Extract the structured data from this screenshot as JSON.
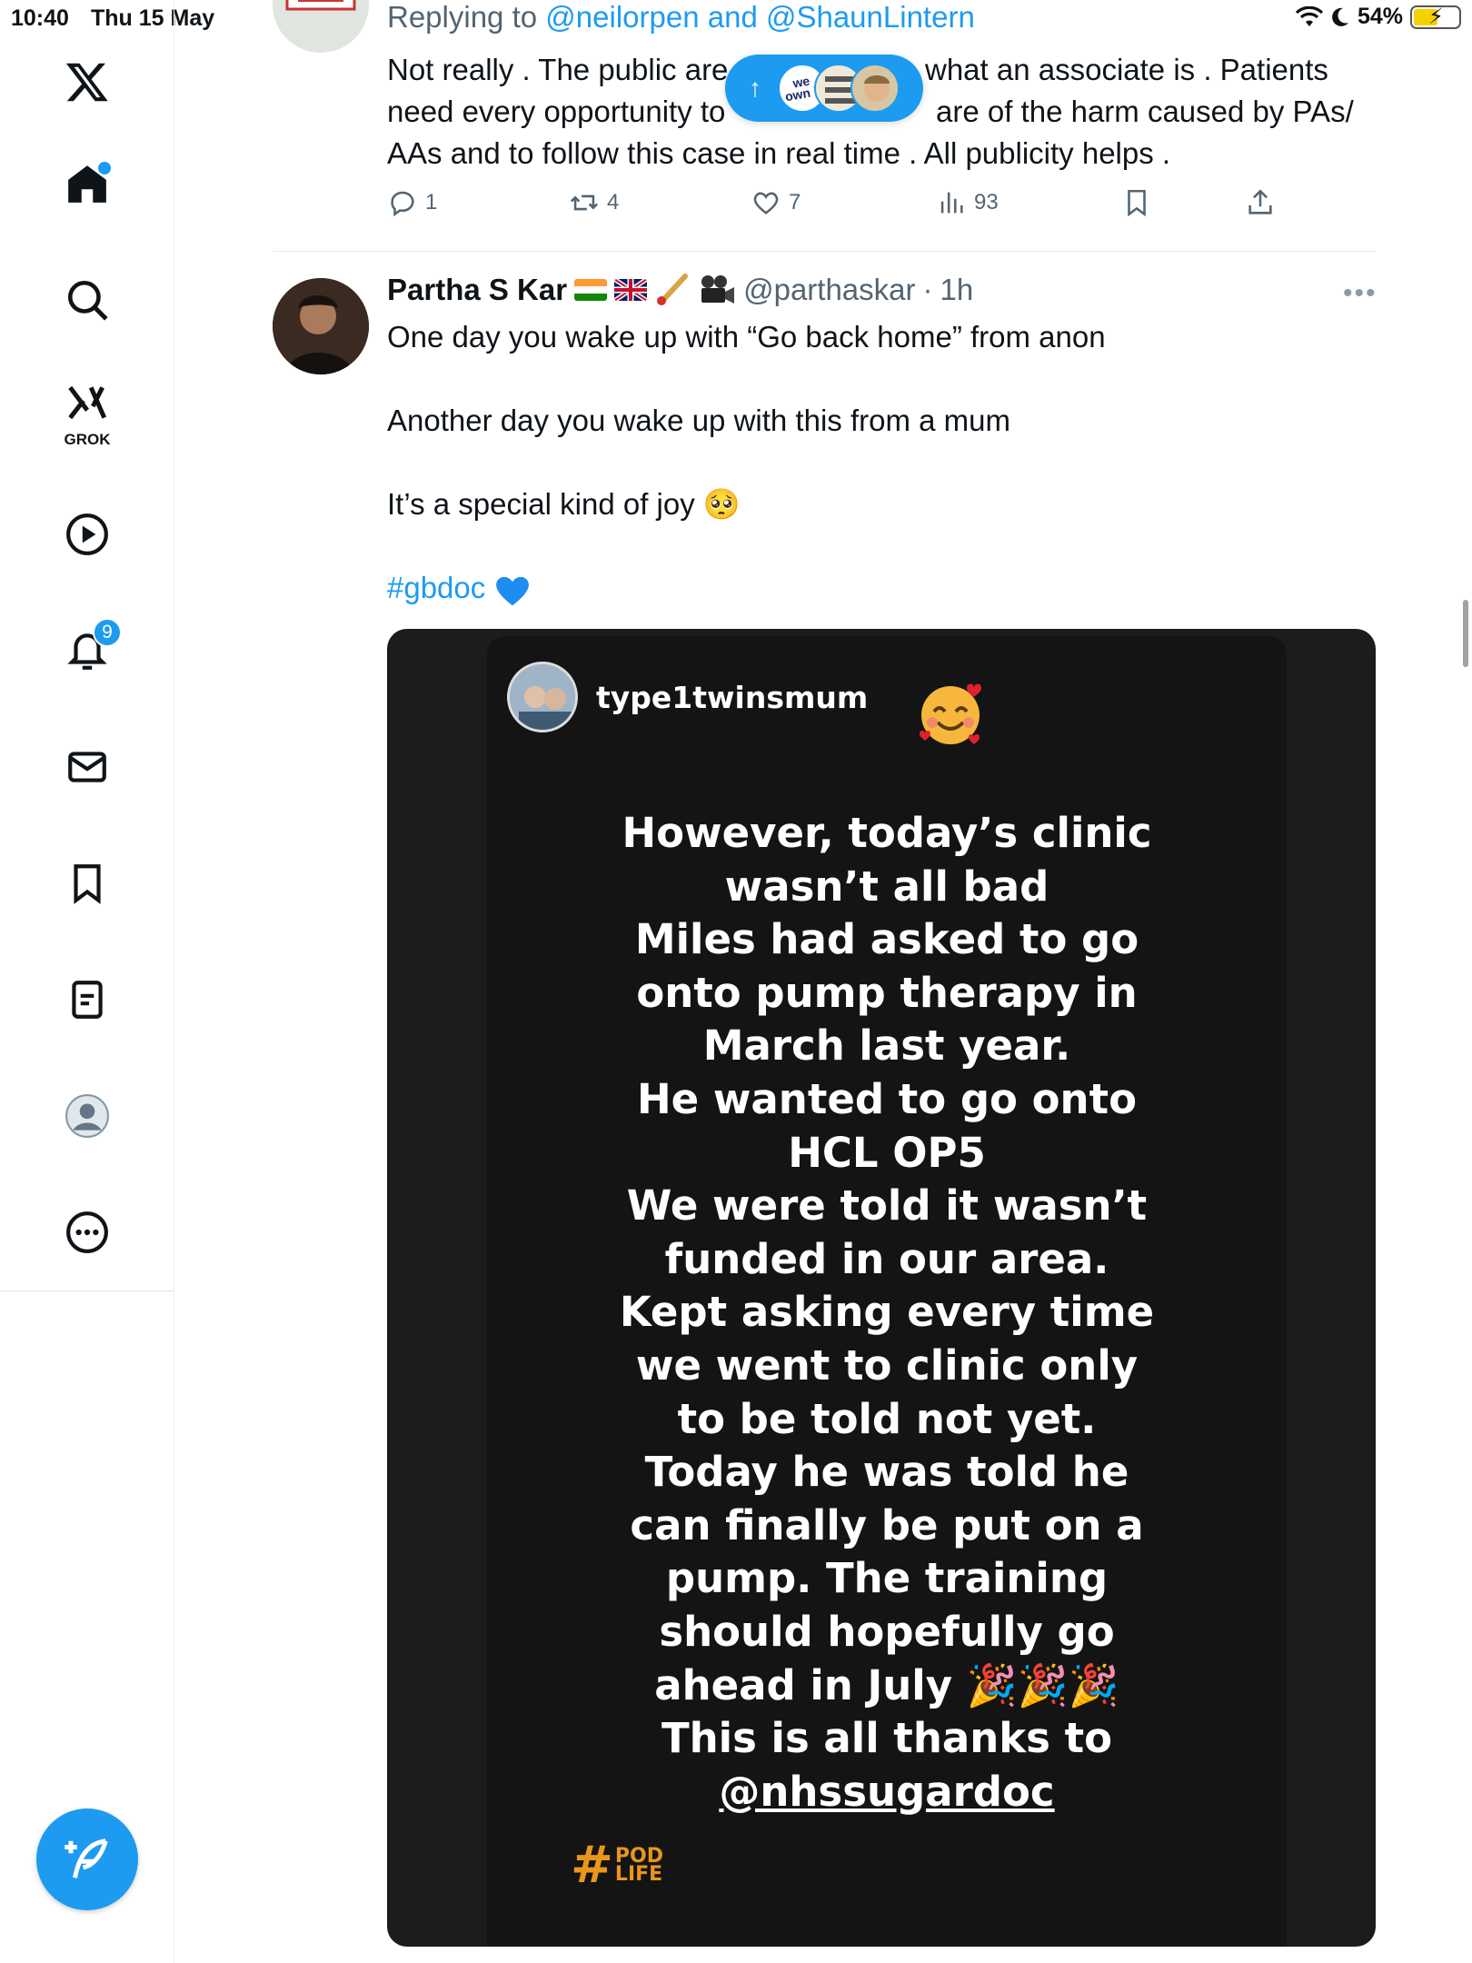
{
  "status_bar": {
    "time": "10:40",
    "date": "Thu 15 May",
    "battery": "54%"
  },
  "sidebar": {
    "notifications_count": "9",
    "grok_label": "GROK"
  },
  "reply_tweet": {
    "replying_prefix": "Replying to",
    "mention1": "@neilorpen",
    "and": "and",
    "mention2": "@ShaunLintern",
    "lines": [
      "Not really . The public are",
      "what an associate is . Patients",
      "need every opportunity to",
      "are of the harm caused by PAs/",
      "AAs and to follow this case in real time . All publicity helps ."
    ],
    "replies": "1",
    "reposts": "4",
    "likes": "7",
    "views": "93"
  },
  "main_tweet": {
    "name": "Partha S Kar",
    "handle": "@parthaskar",
    "dot": "·",
    "time": "1h",
    "lines": [
      "One day you wake up with “Go back home” from anon",
      "Another day you wake up with this from a mum",
      "It’s a special kind of joy 🥺"
    ],
    "hashtag": "#gbdoc"
  },
  "story": {
    "username": "type1twinsmum",
    "text_lines": [
      "However, today’s clinic",
      "wasn’t all bad",
      "Miles had asked to go",
      "onto pump therapy in",
      "March last year.",
      "He wanted to go onto",
      "HCL OP5",
      "We were told it wasn’t",
      "funded in our area.",
      "Kept asking every time",
      "we went to clinic only",
      "to be told not yet.",
      "Today he was told he",
      "can finally be put on a",
      "pump. The training",
      "should hopefully go",
      "ahead in July 🎉🎉🎉",
      "This is all thanks to"
    ],
    "mention": "@nhssugardoc",
    "pod_hash": "#",
    "pod_line1": "POD",
    "pod_line2": "LIFE"
  },
  "new_posts_pill": {
    "arrow": "↑",
    "face_text": "we own it"
  },
  "colors": {
    "accent": "#1d9bf0",
    "text_secondary": "#536471",
    "story_bg": "#141414",
    "pod_orange": "#e8961c"
  }
}
